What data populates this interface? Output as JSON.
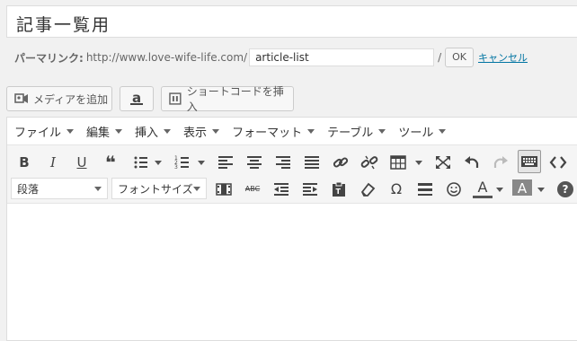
{
  "title": {
    "value": "記事一覧用"
  },
  "permalink": {
    "label": "パーマリンク:",
    "base_url": "http://www.love-wife-life.com/",
    "slug": "article-list",
    "slash": "/",
    "ok_label": "OK",
    "cancel_label": "キャンセル"
  },
  "media_buttons": {
    "add_media": "メディアを追加",
    "amazon": "a",
    "shortcode": "ショートコードを挿入"
  },
  "menubar": {
    "items": [
      "ファイル",
      "編集",
      "挿入",
      "表示",
      "フォーマット",
      "テーブル",
      "ツール"
    ]
  },
  "toolbar": {
    "row1_icons": [
      "bold-icon",
      "italic-icon",
      "underline-icon",
      "blockquote-icon",
      "bullet-list-icon",
      "numbered-list-icon",
      "align-left-icon",
      "align-center-icon",
      "align-right-icon",
      "align-justify-icon",
      "link-icon",
      "unlink-icon",
      "table-icon",
      "fullscreen-icon",
      "undo-icon",
      "redo-icon",
      "toolbar-toggle-icon",
      "code-icon"
    ],
    "format_select": "段落",
    "font_size_select": "フォントサイズ",
    "glyphs": {
      "bold": "B",
      "italic": "I",
      "underline": "U",
      "blockquote": "❝",
      "omega": "Ω",
      "font_color": "A",
      "bg_color": "A",
      "help": "?",
      "strike": "ABC"
    }
  },
  "colors": {
    "link": "#0074a2",
    "accent_underline": "#555555"
  }
}
